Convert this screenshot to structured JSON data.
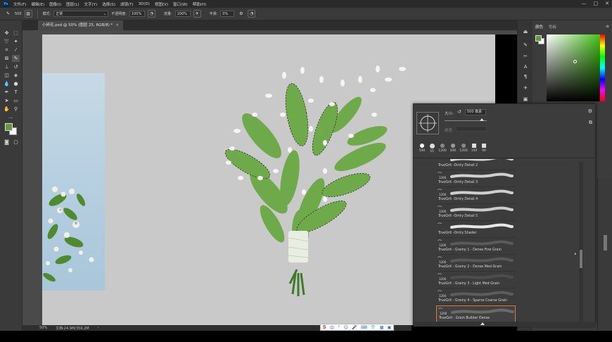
{
  "menubar": {
    "logo": "Ps",
    "items": [
      "文件(F)",
      "编辑(E)",
      "图像(I)",
      "图层(L)",
      "文字(Y)",
      "选择(S)",
      "滤镜(T)",
      "3D(D)",
      "视图(V)",
      "窗口(W)",
      "帮助(H)"
    ],
    "minimize": "—",
    "maximize": "□",
    "close": "✕"
  },
  "options": {
    "brush_size": "500",
    "mode_label": "模式:",
    "mode_value": "正常",
    "opacity_label": "不透明度:",
    "opacity_value": "100%",
    "flow_label": "流量:",
    "flow_value": "100%",
    "smoothing_label": "平滑:",
    "smoothing_value": "0%"
  },
  "document": {
    "tab_title": "小碎花.psd @ 50% (图层 25, RGB/8) *",
    "close": "×",
    "zoom": "50%",
    "doc_info": "文档:24.9M/359.2M"
  },
  "ime": {
    "logo": "S",
    "items": [
      "中",
      "°",
      "☺",
      "🎤",
      "⌨",
      "👕",
      "▦",
      "▣"
    ]
  },
  "color_panel": {
    "tabs": [
      "颜色",
      "色板"
    ],
    "menu": "≡",
    "foreground": "#5f9b3a",
    "background": "#ffffff"
  },
  "brush_panel": {
    "size_label": "大小:",
    "size_value": "500 像素",
    "hardness_label": "硬度:",
    "recent_sizes": [
      "500",
      "55",
      "1200",
      "400",
      "1200",
      "150",
      "90"
    ],
    "brushes": [
      {
        "size": "",
        "name": "TrueGrit -Ornty Detail 2",
        "stroke": "#d9d9d9"
      },
      {
        "size": "1200",
        "name": "TrueGrit -Ornty Detail 3",
        "stroke": "#d0d0d0"
      },
      {
        "size": "1200",
        "name": "TrueGrit -Ornty Detail 4",
        "stroke": "#cfcfcf"
      },
      {
        "size": "1200",
        "name": "TrueGrit -Ornty Detail 5",
        "stroke": "#cbcbcb"
      },
      {
        "size": "",
        "name": "TrueGrit -Ornty Shader",
        "stroke": "#e8e8e8"
      },
      {
        "size": "1200",
        "name": "TrueGrit - Grainy 1 - Dense Fine Grain",
        "stroke": "#5a5a5a"
      },
      {
        "size": "1200",
        "name": "TrueGrit - Grainy 2 - Dense Med Grain",
        "stroke": "#585858"
      },
      {
        "size": "1200",
        "name": "TrueGrit - Grainy 3 - Light Med Grain",
        "stroke": "#4d4d4d"
      },
      {
        "size": "1200",
        "name": "TrueGrit - Grainy 4 - Sparse Coarse Grain",
        "stroke": "#5c5c5c"
      },
      {
        "size": "1200",
        "name": "TrueGrit - Grain Builder Dense",
        "stroke": "#6a6a6a"
      }
    ]
  }
}
